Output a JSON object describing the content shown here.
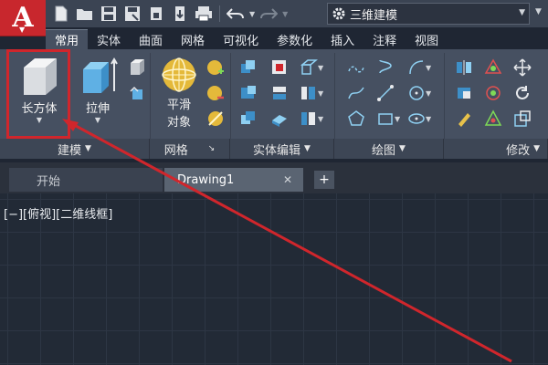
{
  "app": {
    "logo_letter": "A"
  },
  "workspace": {
    "label": "三维建模"
  },
  "tabs": [
    "常用",
    "实体",
    "曲面",
    "网格",
    "可视化",
    "参数化",
    "插入",
    "注释",
    "视图"
  ],
  "ribbon": {
    "box_label": "长方体",
    "extrude_label": "拉伸",
    "smooth_label_1": "平滑",
    "smooth_label_2": "对象",
    "panels": {
      "modeling": "建模",
      "mesh": "网格",
      "solid_edit": "实体编辑",
      "draw": "绘图",
      "modify": "修改"
    }
  },
  "doc_tabs": {
    "start": "开始",
    "drawing": "Drawing1",
    "close": "✕",
    "new": "+"
  },
  "viewport": {
    "label": "[−][俯视][二维线框]"
  },
  "colors": {
    "accent_red": "#c8272d",
    "annotation_red": "#d0262c"
  }
}
